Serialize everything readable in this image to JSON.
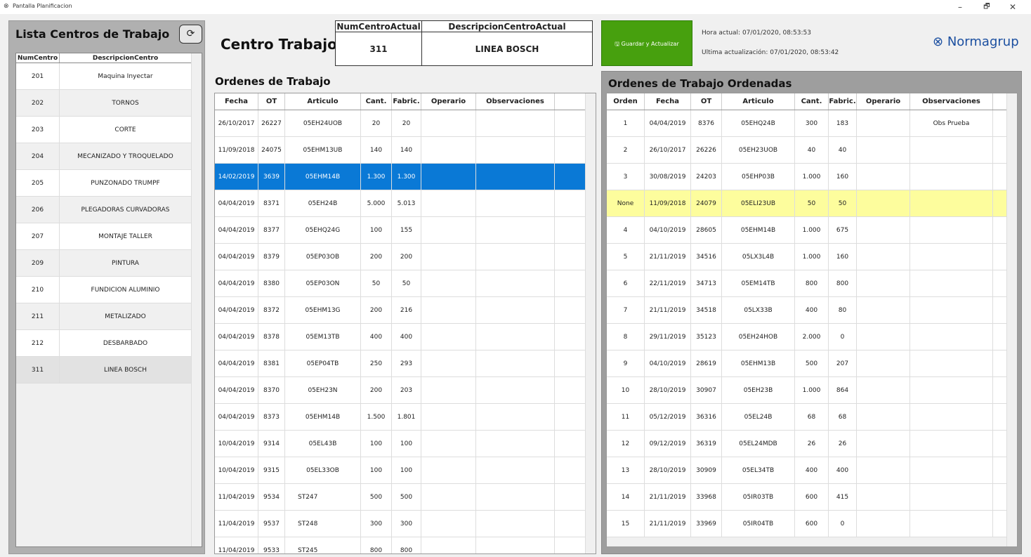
{
  "window": {
    "title": "Pantalla Planificacion",
    "icon": "app-logo-icon",
    "min": "–",
    "max": "🗗",
    "close": "✕"
  },
  "left_panel": {
    "title": "Lista Centros de Trabajo",
    "refresh_icon": "refresh-icon",
    "headers": [
      "NumCentro",
      "DescripcionCentro"
    ],
    "rows": [
      [
        "201",
        "Maquina Inyectar"
      ],
      [
        "202",
        "TORNOS"
      ],
      [
        "203",
        "CORTE"
      ],
      [
        "204",
        "MECANIZADO Y TROQUELADO"
      ],
      [
        "205",
        "PUNZONADO TRUMPF"
      ],
      [
        "206",
        "PLEGADORAS CURVADORAS"
      ],
      [
        "207",
        "MONTAJE TALLER"
      ],
      [
        "209",
        "PINTURA"
      ],
      [
        "210",
        "FUNDICION ALUMINIO"
      ],
      [
        "211",
        "METALIZADO"
      ],
      [
        "212",
        "DESBARBADO"
      ],
      [
        "311",
        "LINEA BOSCH"
      ]
    ],
    "selected_index": 11
  },
  "header": {
    "title": "Centro Trabajo",
    "current": {
      "head_num": "NumCentroActual",
      "head_desc": "DescripcionCentroActual",
      "num": "311",
      "desc": "LINEA BOSCH"
    },
    "save_button": "Guardar y Actualizar",
    "save_icon": "save-icon",
    "hora_actual": "Hora actual: 07/01/2020, 08:53:53",
    "ultima_actualizacion": "Ultima actualización: 07/01/2020, 08:53:42",
    "brand": "Normagrup",
    "brand_icon": "normagrup-logo-icon"
  },
  "ordenes": {
    "title": "Ordenes de Trabajo",
    "headers": [
      "Fecha",
      "OT",
      "Articulo",
      "Cant.",
      "Fabric.",
      "Operario",
      "Observaciones"
    ],
    "rows": [
      [
        "26/10/2017",
        "26227",
        "05EH24UOB",
        "20",
        "20",
        "",
        ""
      ],
      [
        "11/09/2018",
        "24075",
        "05EHM13UB",
        "140",
        "140",
        "",
        ""
      ],
      [
        "14/02/2019",
        "3639",
        "05EHM14B",
        "1.300",
        "1.300",
        "",
        ""
      ],
      [
        "04/04/2019",
        "8371",
        "05EH24B",
        "5.000",
        "5.013",
        "",
        ""
      ],
      [
        "04/04/2019",
        "8377",
        "05EHQ24G",
        "100",
        "155",
        "",
        ""
      ],
      [
        "04/04/2019",
        "8379",
        "05EP03OB",
        "200",
        "200",
        "",
        ""
      ],
      [
        "04/04/2019",
        "8380",
        "05EP03ON",
        "50",
        "50",
        "",
        ""
      ],
      [
        "04/04/2019",
        "8372",
        "05EHM13G",
        "200",
        "216",
        "",
        ""
      ],
      [
        "04/04/2019",
        "8378",
        "05EM13TB",
        "400",
        "400",
        "",
        ""
      ],
      [
        "04/04/2019",
        "8381",
        "05EP04TB",
        "250",
        "293",
        "",
        ""
      ],
      [
        "04/04/2019",
        "8370",
        "05EH23N",
        "200",
        "203",
        "",
        ""
      ],
      [
        "04/04/2019",
        "8373",
        "05EHM14B",
        "1.500",
        "1.801",
        "",
        ""
      ],
      [
        "10/04/2019",
        "9314",
        "05EL43B",
        "100",
        "100",
        "",
        ""
      ],
      [
        "10/04/2019",
        "9315",
        "05EL33OB",
        "100",
        "100",
        "",
        ""
      ],
      [
        "11/04/2019",
        "9534",
        "ST247",
        "500",
        "500",
        "",
        ""
      ],
      [
        "11/04/2019",
        "9537",
        "ST248",
        "300",
        "300",
        "",
        ""
      ],
      [
        "11/04/2019",
        "9533",
        "ST245",
        "800",
        "800",
        "",
        ""
      ]
    ],
    "selected_index": 2
  },
  "ordenadas": {
    "title": "Ordenes de Trabajo Ordenadas",
    "headers": [
      "Orden",
      "Fecha",
      "OT",
      "Articulo",
      "Cant.",
      "Fabric.",
      "Operario",
      "Observaciones"
    ],
    "rows": [
      [
        "1",
        "04/04/2019",
        "8376",
        "05EHQ24B",
        "300",
        "183",
        "",
        "Obs Prueba"
      ],
      [
        "2",
        "26/10/2017",
        "26226",
        "05EH23UOB",
        "40",
        "40",
        "",
        ""
      ],
      [
        "3",
        "30/08/2019",
        "24203",
        "05EHP03B",
        "1.000",
        "160",
        "",
        ""
      ],
      [
        "None",
        "11/09/2018",
        "24079",
        "05ELI23UB",
        "50",
        "50",
        "",
        ""
      ],
      [
        "4",
        "04/10/2019",
        "28605",
        "05EHM14B",
        "1.000",
        "675",
        "",
        ""
      ],
      [
        "5",
        "21/11/2019",
        "34516",
        "05LX3L4B",
        "1.000",
        "160",
        "",
        ""
      ],
      [
        "6",
        "22/11/2019",
        "34713",
        "05EM14TB",
        "800",
        "800",
        "",
        ""
      ],
      [
        "7",
        "21/11/2019",
        "34518",
        "05LX33B",
        "400",
        "80",
        "",
        ""
      ],
      [
        "8",
        "29/11/2019",
        "35123",
        "05EH24HOB",
        "2.000",
        "0",
        "",
        ""
      ],
      [
        "9",
        "04/10/2019",
        "28619",
        "05EHM13B",
        "500",
        "207",
        "",
        ""
      ],
      [
        "10",
        "28/10/2019",
        "30907",
        "05EH23B",
        "1.000",
        "864",
        "",
        ""
      ],
      [
        "11",
        "05/12/2019",
        "36316",
        "05EL24B",
        "68",
        "68",
        "",
        ""
      ],
      [
        "12",
        "09/12/2019",
        "36319",
        "05EL24MDB",
        "26",
        "26",
        "",
        ""
      ],
      [
        "13",
        "28/10/2019",
        "30909",
        "05EL34TB",
        "400",
        "400",
        "",
        ""
      ],
      [
        "14",
        "21/11/2019",
        "33968",
        "05IR03TB",
        "600",
        "415",
        "",
        ""
      ],
      [
        "15",
        "21/11/2019",
        "33969",
        "05IR04TB",
        "600",
        "0",
        "",
        ""
      ]
    ],
    "highlighted_index": 3
  },
  "colors": {
    "selection": "#0a79d6",
    "highlight": "#fdfd9d",
    "save_button": "#47a00e",
    "brand": "#1b4fa0"
  }
}
